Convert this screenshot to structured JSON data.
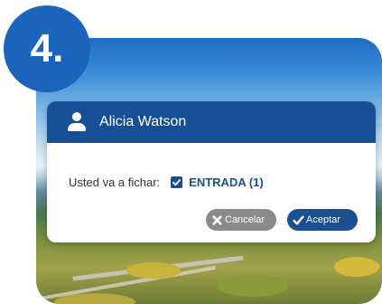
{
  "step": {
    "label": "4."
  },
  "dialog": {
    "user_name": "Alicia Watson",
    "prompt": "Usted va a fichar:",
    "entry_label": "ENTRADA (1)",
    "entry_checked": true
  },
  "buttons": {
    "cancel_label": "Cancelar",
    "accept_label": "Aceptar"
  },
  "colors": {
    "header": "#164f96",
    "badge": "#1b64be",
    "cancel": "#8a8a8a",
    "accept": "#1b4f8f"
  },
  "icons": {
    "header": "user-icon",
    "checkbox": "checkbox-checked-icon",
    "cancel": "x-icon",
    "accept": "checkmark-icon"
  }
}
